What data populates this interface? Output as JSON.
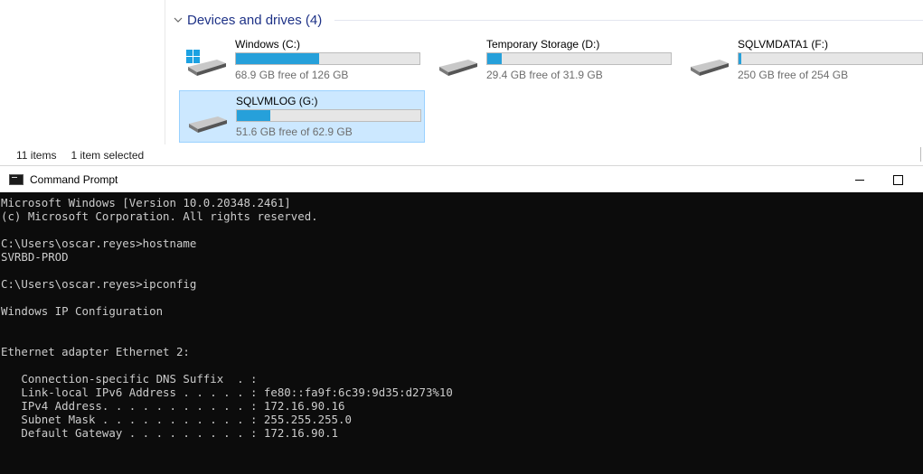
{
  "explorer": {
    "group_title": "Devices and drives (4)",
    "drives": [
      {
        "name": "Windows (C:)",
        "free_text": "68.9 GB free of 126 GB",
        "used_fraction": 0.453,
        "icon": "windows-drive-icon",
        "selected": false
      },
      {
        "name": "Temporary Storage (D:)",
        "free_text": "29.4 GB free of 31.9 GB",
        "used_fraction": 0.078,
        "icon": "hard-drive-icon",
        "selected": false
      },
      {
        "name": "SQLVMDATA1 (F:)",
        "free_text": "250 GB free of 254 GB",
        "used_fraction": 0.016,
        "icon": "hard-drive-icon",
        "selected": false
      },
      {
        "name": "SQLVMLOG (G:)",
        "free_text": "51.6 GB free of 62.9 GB",
        "used_fraction": 0.18,
        "icon": "hard-drive-icon",
        "selected": true
      }
    ],
    "status": {
      "item_count": "11 items",
      "selection": "1 item selected"
    }
  },
  "cmd": {
    "title": "Command Prompt",
    "lines": [
      "Microsoft Windows [Version 10.0.20348.2461]",
      "(c) Microsoft Corporation. All rights reserved.",
      "",
      "C:\\Users\\oscar.reyes>hostname",
      "SVRBD-PROD",
      "",
      "C:\\Users\\oscar.reyes>ipconfig",
      "",
      "Windows IP Configuration",
      "",
      "",
      "Ethernet adapter Ethernet 2:",
      "",
      "   Connection-specific DNS Suffix  . :",
      "   Link-local IPv6 Address . . . . . : fe80::fa9f:6c39:9d35:d273%10",
      "   IPv4 Address. . . . . . . . . . . : 172.16.90.16",
      "   Subnet Mask . . . . . . . . . . . : 255.255.255.0",
      "   Default Gateway . . . . . . . . . : 172.16.90.1"
    ]
  },
  "colors": {
    "accent_blue": "#26a0da",
    "selection_bg": "#cce8ff",
    "console_bg": "#0c0c0c",
    "console_fg": "#cccccc",
    "group_title": "#1e3287"
  }
}
